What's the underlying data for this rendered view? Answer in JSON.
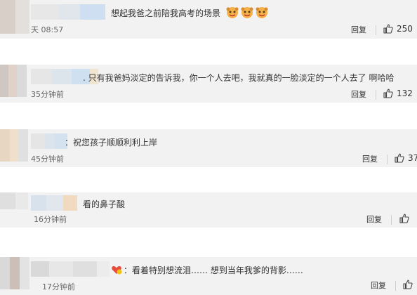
{
  "comments": [
    {
      "text": "想起我爸之前陪我高考的场景",
      "time": "天 08:57",
      "reply": "回复",
      "likes": "250",
      "emoji": "dog-face-emoji"
    },
    {
      "text": ". 只有我爸妈淡定的告诉我，你一个人去吧，我就真的一脸淡定的一个人去了 啊哈哈",
      "time": "35分钟前",
      "reply": "回复",
      "likes": "132"
    },
    {
      "text": "：祝您孩子顺顺利利上岸",
      "time": "45分钟前",
      "reply": "回复",
      "likes": "37"
    },
    {
      "text": "看的鼻子酸",
      "time": "16分钟前",
      "reply": "回复",
      "likes": ""
    },
    {
      "text": "：看着特别想流泪……  想到当年我爹的背影……",
      "time": "17分钟前",
      "reply": "回复",
      "likes": ""
    }
  ],
  "colors": {
    "card_bg": "#f2f2f2",
    "text": "#333333",
    "muted": "#666666"
  }
}
